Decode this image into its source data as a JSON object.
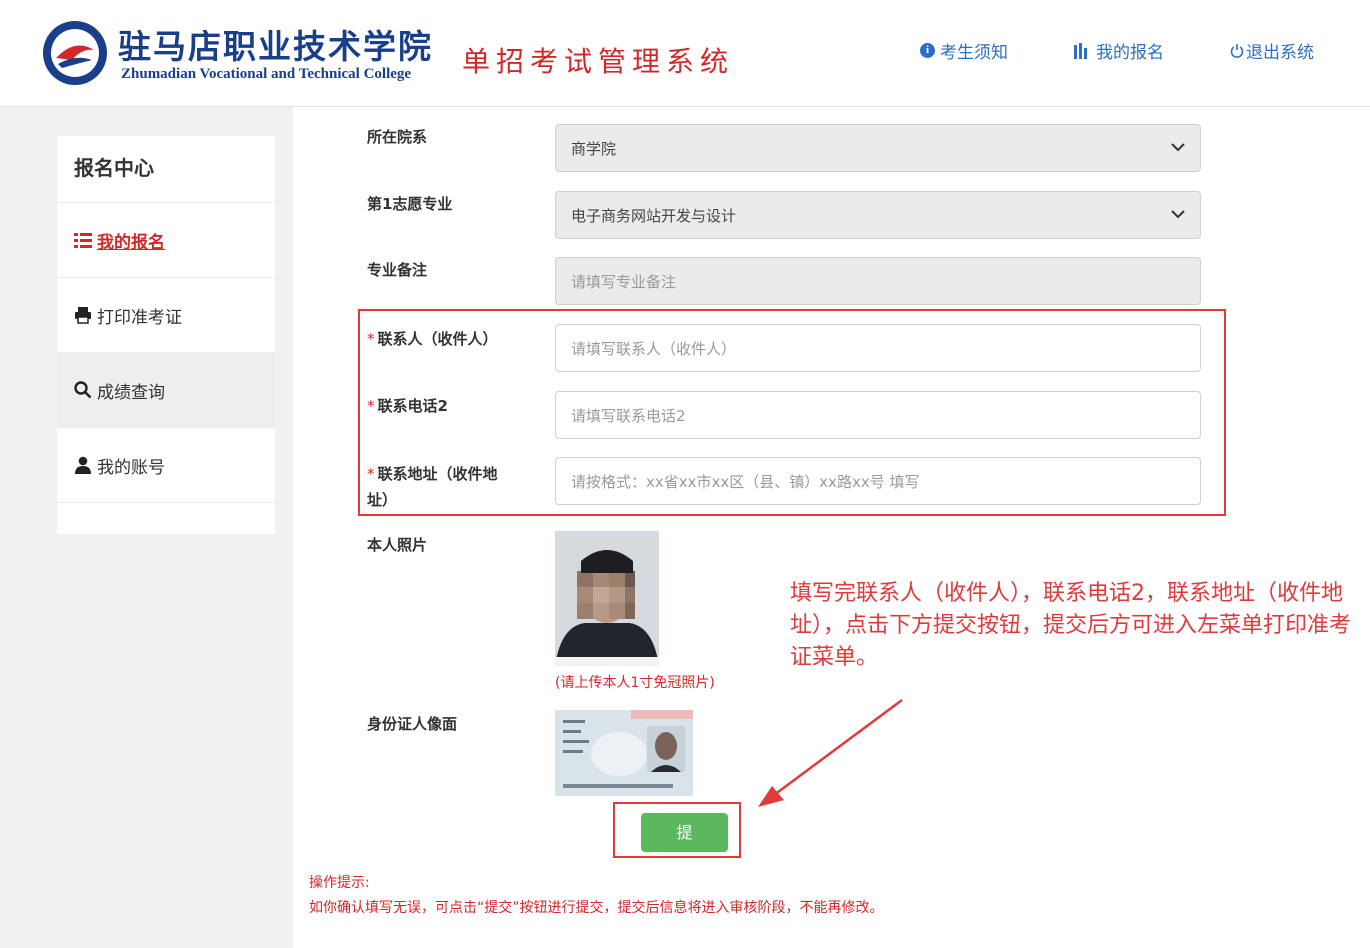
{
  "header": {
    "school_name_cn": "驻马店职业技术学院",
    "school_name_en": "Zhumadian Vocational and Technical College",
    "system_title": "单招考试管理系统",
    "nav": [
      {
        "label": "考生须知",
        "icon": "info-circle-icon"
      },
      {
        "label": "我的报名",
        "icon": "bar-chart-icon"
      },
      {
        "label": "退出系统",
        "icon": "power-icon"
      }
    ]
  },
  "sidebar": {
    "title": "报名中心",
    "items": [
      {
        "label": "我的报名",
        "icon": "list-icon",
        "active": true
      },
      {
        "label": "打印准考证",
        "icon": "printer-icon"
      },
      {
        "label": "成绩查询",
        "icon": "search-icon"
      },
      {
        "label": "我的账号",
        "icon": "user-icon"
      }
    ]
  },
  "form": {
    "department": {
      "label": "所在院系",
      "value": "商学院"
    },
    "major": {
      "label": "第1志愿专业",
      "value": "电子商务网站开发与设计"
    },
    "major_note": {
      "label": "专业备注",
      "placeholder": "请填写专业备注"
    },
    "contact": {
      "label": "联系人（收件人）",
      "placeholder": "请填写联系人（收件人）",
      "required_mark": "*"
    },
    "phone2": {
      "label": "联系电话2",
      "placeholder": "请填写联系电话2",
      "required_mark": "*"
    },
    "address": {
      "label_line1": "联系地址（收件地",
      "label_line2": "址）",
      "placeholder": "请按格式：xx省xx市xx区（县、镇）xx路xx号 填写",
      "required_mark": "*"
    },
    "photo": {
      "label": "本人照片",
      "note": "(请上传本人1寸免冠照片)"
    },
    "id_card": {
      "label": "身份证人像面"
    },
    "submit_label": "提交"
  },
  "hint": {
    "title": "操作提示:",
    "body": "如你确认填写无误，可点击“提交”按钮进行提交，提交后信息将进入审核阶段，不能再修改。"
  },
  "annotation": "填写完联系人（收件人），联系电话2，联系地址（收件地址），点击下方提交按钮，提交后方可进入左菜单打印准考证菜单。",
  "colors": {
    "brand_red": "#d1282a",
    "link_blue": "#2c6fc4",
    "success_green": "#5cb85c",
    "logo_blue": "#1a3f8a"
  }
}
